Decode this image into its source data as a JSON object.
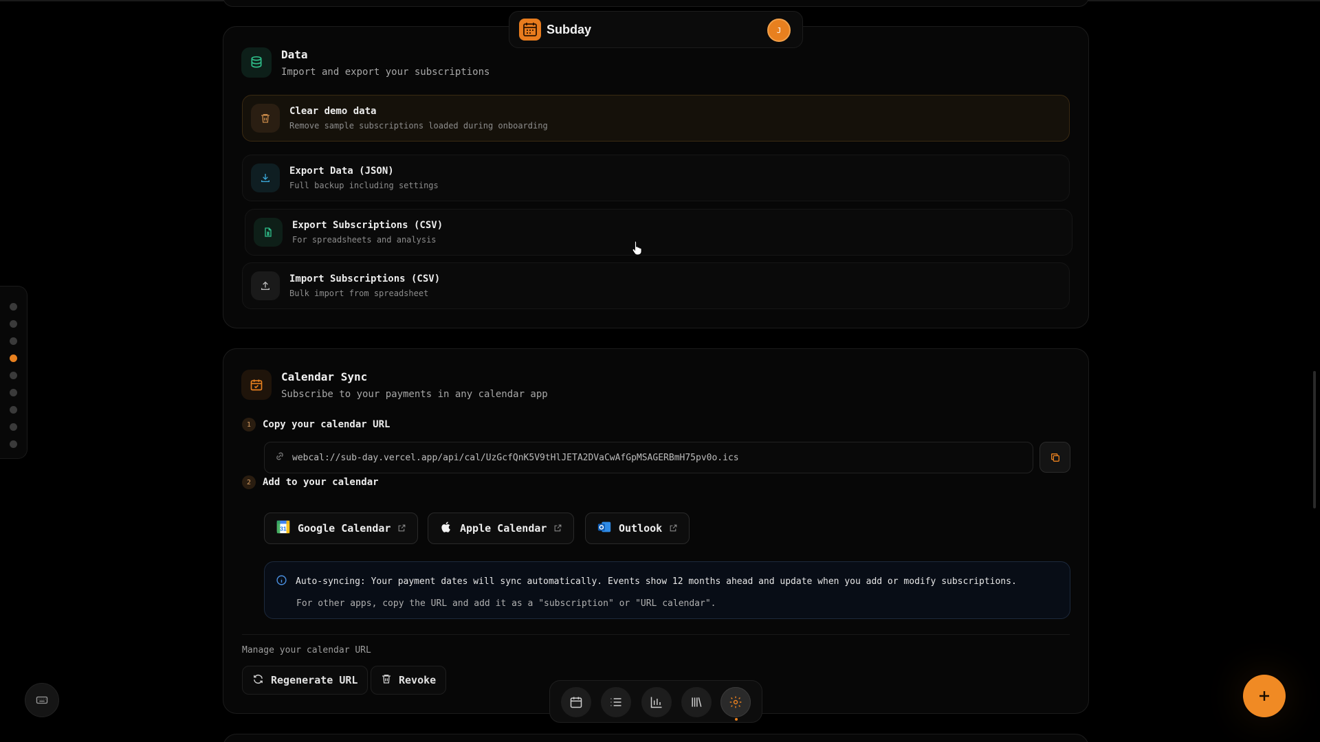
{
  "app": {
    "name": "Subday",
    "avatar_initial": "J"
  },
  "data_section": {
    "title": "Data",
    "subtitle": "Import and export your subscriptions",
    "items": [
      {
        "title": "Clear demo data",
        "subtitle": "Remove sample subscriptions loaded during onboarding",
        "icon": "trash-icon"
      },
      {
        "title": "Export Data (JSON)",
        "subtitle": "Full backup including settings",
        "icon": "download-icon"
      },
      {
        "title": "Export Subscriptions (CSV)",
        "subtitle": "For spreadsheets and analysis",
        "icon": "file-spreadsheet-icon"
      },
      {
        "title": "Import Subscriptions (CSV)",
        "subtitle": "Bulk import from spreadsheet",
        "icon": "upload-icon"
      }
    ]
  },
  "calendar_section": {
    "title": "Calendar Sync",
    "subtitle": "Subscribe to your payments in any calendar app",
    "step1": {
      "num": "1",
      "label": "Copy your calendar URL"
    },
    "url": "webcal://sub-day.vercel.app/api/cal/UzGcfQnK5V9tHlJETA2DVaCwAfGpMSAGERBmH75pv0o.ics",
    "step2": {
      "num": "2",
      "label": "Add to your calendar"
    },
    "buttons": {
      "google": "Google Calendar",
      "apple": "Apple Calendar",
      "outlook": "Outlook"
    },
    "info": {
      "line1": "Auto-syncing: Your payment dates will sync automatically. Events show 12 months ahead and update when you add or modify subscriptions.",
      "line2": "For other apps, copy the URL and add it as a \"subscription\" or \"URL calendar\"."
    },
    "manage_label": "Manage your calendar URL",
    "regenerate_label": "Regenerate URL",
    "revoke_label": "Revoke"
  },
  "side_nav": {
    "dot_count": 9,
    "active_index": 3
  },
  "bottom_nav": {
    "items": [
      "calendar-icon",
      "list-icon",
      "bar-chart-icon",
      "library-icon",
      "settings-icon"
    ],
    "active": "settings-icon"
  },
  "colors": {
    "accent": "#e8801f",
    "background": "#000000",
    "info": "#4a8fe0",
    "data_icon": "#2fbf8a"
  }
}
